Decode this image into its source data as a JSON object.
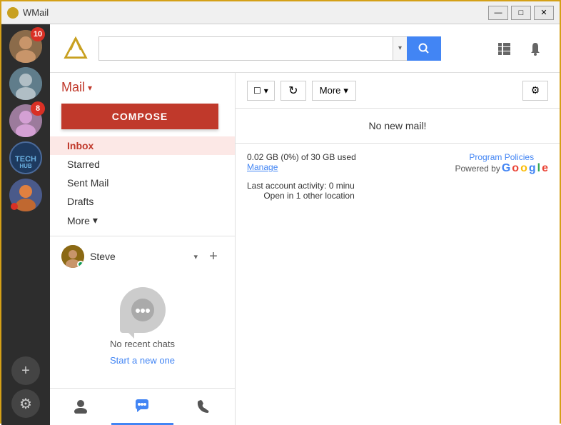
{
  "titleBar": {
    "appName": "WMail",
    "controls": {
      "minimize": "—",
      "maximize": "□",
      "close": "✕"
    }
  },
  "topBar": {
    "searchPlaceholder": "",
    "searchDropdownArrow": "▾",
    "searchIcon": "🔍",
    "gridIcon": "⊞",
    "bellIcon": "🔔"
  },
  "leftPanel": {
    "mailLabel": "Mail",
    "composeLabel": "COMPOSE",
    "navItems": [
      {
        "label": "Inbox",
        "active": true
      },
      {
        "label": "Starred"
      },
      {
        "label": "Sent Mail"
      },
      {
        "label": "Drafts"
      },
      {
        "label": "More",
        "hasArrow": true
      }
    ],
    "chat": {
      "userName": "Steve",
      "userArrow": "▾",
      "addLabel": "+",
      "noChatsLine1": "No recent chats",
      "noChatsLine2": "Start a new one"
    },
    "bottomTabs": [
      {
        "icon": "👤",
        "active": false,
        "label": "contacts"
      },
      {
        "icon": "💬",
        "active": true,
        "label": "chat"
      },
      {
        "icon": "📞",
        "active": false,
        "label": "phone"
      }
    ]
  },
  "rightPanel": {
    "toolbar": {
      "checkboxLabel": "",
      "checkboxArrow": "▾",
      "refreshIcon": "↻",
      "moreLabel": "More",
      "moreArrow": "▾",
      "settingsIcon": "⚙"
    },
    "noMailBanner": "No new mail!",
    "footer": {
      "storageText": "0.02 GB (0%) of 30 GB used",
      "manageLabel": "Manage",
      "policyLabel": "Program Policies",
      "poweredByLabel": "Powered by",
      "googleLetters": [
        "G",
        "o",
        "o",
        "g",
        "l",
        "e"
      ],
      "activityLine1": "Last account activity: 0 minu",
      "activityLine2": "Open in 1 other location"
    }
  },
  "avatarSidebar": {
    "avatars": [
      {
        "badge": "10",
        "color": "#8b6b4a"
      },
      {
        "badge": null,
        "color": "#5a7fa0"
      },
      {
        "badge": "8",
        "color": "#7a6090"
      },
      {
        "badge": null,
        "color": "#4a7a5a"
      },
      {
        "badge": null,
        "color": "#3a4a7a"
      }
    ],
    "addBtn": "+",
    "settingsIcon": "⚙"
  }
}
